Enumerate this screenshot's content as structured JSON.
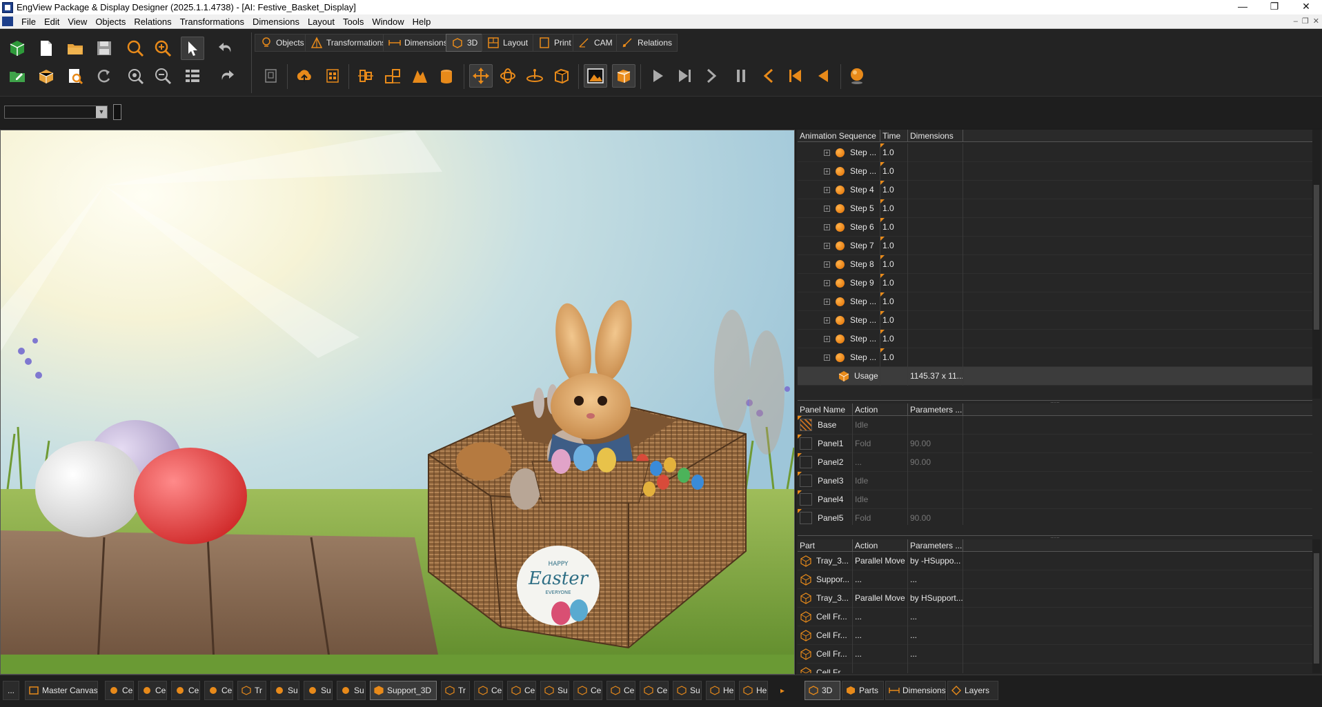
{
  "window": {
    "title": "EngView Package & Display Designer (2025.1.1.4738) - [AI: Festive_Basket_Display]",
    "min_label": "—",
    "max_label": "❐",
    "close_label": "✕"
  },
  "menu": [
    "File",
    "Edit",
    "View",
    "Objects",
    "Relations",
    "Transformations",
    "Dimensions",
    "Layout",
    "Tools",
    "Window",
    "Help"
  ],
  "mdi_buttons": [
    "–",
    "❐",
    "✕"
  ],
  "mode_tabs": [
    "Objects",
    "Transformations",
    "Dimensions",
    "3D",
    "Layout",
    "Print",
    "CAM",
    "Relations"
  ],
  "active_mode_tab": "3D",
  "animation_table": {
    "headers": [
      "Animation Sequence",
      "Time",
      "Dimensions"
    ],
    "rows": [
      {
        "name": "Step ...",
        "time": "1.0",
        "dims": ""
      },
      {
        "name": "Step ...",
        "time": "1.0",
        "dims": ""
      },
      {
        "name": "Step 4",
        "time": "1.0",
        "dims": ""
      },
      {
        "name": "Step 5",
        "time": "1.0",
        "dims": ""
      },
      {
        "name": "Step 6",
        "time": "1.0",
        "dims": ""
      },
      {
        "name": "Step 7",
        "time": "1.0",
        "dims": ""
      },
      {
        "name": "Step 8",
        "time": "1.0",
        "dims": ""
      },
      {
        "name": "Step 9",
        "time": "1.0",
        "dims": ""
      },
      {
        "name": "Step ...",
        "time": "1.0",
        "dims": ""
      },
      {
        "name": "Step ...",
        "time": "1.0",
        "dims": ""
      },
      {
        "name": "Step ...",
        "time": "1.0",
        "dims": ""
      },
      {
        "name": "Step ...",
        "time": "1.0",
        "dims": ""
      }
    ],
    "usage": {
      "name": "Usage",
      "time": "",
      "dims": "1145.37 x 11..."
    }
  },
  "panel_table": {
    "headers": [
      "Panel Name",
      "Action",
      "Parameters ..."
    ],
    "rows": [
      {
        "name": "Base",
        "action": "Idle",
        "params": ""
      },
      {
        "name": "Panel1",
        "action": "Fold",
        "params": "90.00"
      },
      {
        "name": "Panel2",
        "action": "...",
        "params": "90.00"
      },
      {
        "name": "Panel3",
        "action": "Idle",
        "params": ""
      },
      {
        "name": "Panel4",
        "action": "Idle",
        "params": ""
      },
      {
        "name": "Panel5",
        "action": "Fold",
        "params": "90.00"
      }
    ]
  },
  "part_table": {
    "headers": [
      "Part",
      "Action",
      "Parameters ..."
    ],
    "rows": [
      {
        "name": "Tray_3...",
        "action": "Parallel Move",
        "params": "by -HSuppo..."
      },
      {
        "name": "Suppor...",
        "action": "...",
        "params": "..."
      },
      {
        "name": "Tray_3...",
        "action": "Parallel Move",
        "params": "by HSupport..."
      },
      {
        "name": "Cell Fr...",
        "action": "...",
        "params": "..."
      },
      {
        "name": "Cell Fr...",
        "action": "...",
        "params": "..."
      },
      {
        "name": "Cell Fr...",
        "action": "...",
        "params": "..."
      },
      {
        "name": "Cell Fr...",
        "action": "...",
        "params": "..."
      }
    ]
  },
  "bottom_tabs": {
    "overflow": "...",
    "master": "Master Canvas",
    "docs": [
      "Ce",
      "Ce",
      "Ce",
      "Ce",
      "Tr",
      "Su",
      "Su",
      "Su",
      "Support_3D",
      "Tr",
      "Ce",
      "Ce",
      "Su",
      "Ce",
      "Ce",
      "Ce",
      "Su",
      "He",
      "He"
    ],
    "active_doc": "Support_3D",
    "scroll_arrow": "▸",
    "right_tabs": [
      "3D",
      "Parts",
      "Dimensions",
      "Layers"
    ]
  },
  "viewport": {
    "basket_label_top": "HAPPY",
    "basket_label_main": "Easter",
    "basket_label_bottom": "EVERYONE"
  },
  "colors": {
    "accent": "#e88a1a",
    "background": "#1d1d1d"
  }
}
